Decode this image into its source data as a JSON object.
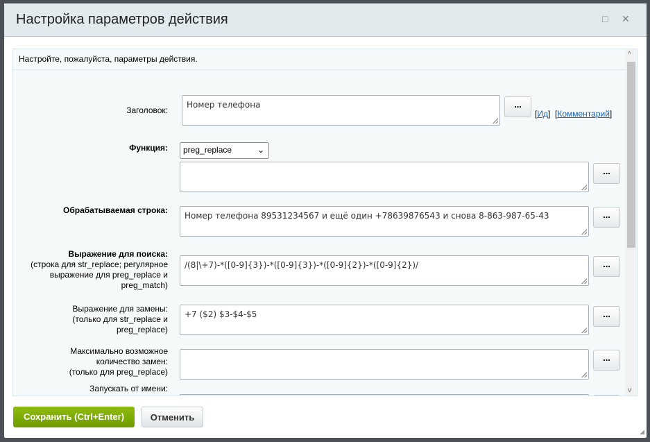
{
  "dialog": {
    "title": "Настройка параметров действия",
    "maximize_icon": "square-icon",
    "close_icon": "close-icon"
  },
  "info": "Настройте, пожалуйста, параметры действия.",
  "fields": {
    "title": {
      "label": "Заголовок:",
      "value": "Номер телефона",
      "link_id": "Ид",
      "link_comment": "Комментарий"
    },
    "function": {
      "label": "Функция:",
      "selected": "preg_replace",
      "value": ""
    },
    "string": {
      "label": "Обрабатываемая строка:",
      "value": "Номер телефона 89531234567 и ещё один +78639876543 и снова 8-863-987-65-43"
    },
    "search": {
      "label": "Выражение для поиска:",
      "hint": "(строка для str_replace; регулярное выражение для preg_replace и preg_match)",
      "value": "/(8|\\+7)-*([0-9]{3})-*([0-9]{3})-*([0-9]{2})-*([0-9]{2})/"
    },
    "replace": {
      "label": "Выражение для замены:",
      "hint": "(только для str_replace и preg_replace)",
      "value": "+7 ($2) $3-$4-$5"
    },
    "max": {
      "label": "Максимально возможное количество замен:",
      "hint": "(только для preg_replace)",
      "value": ""
    },
    "runas": {
      "label": "Запускать от имени:",
      "value": ""
    }
  },
  "dots_label": "...",
  "footer": {
    "save": "Сохранить (Ctrl+Enter)",
    "cancel": "Отменить"
  }
}
